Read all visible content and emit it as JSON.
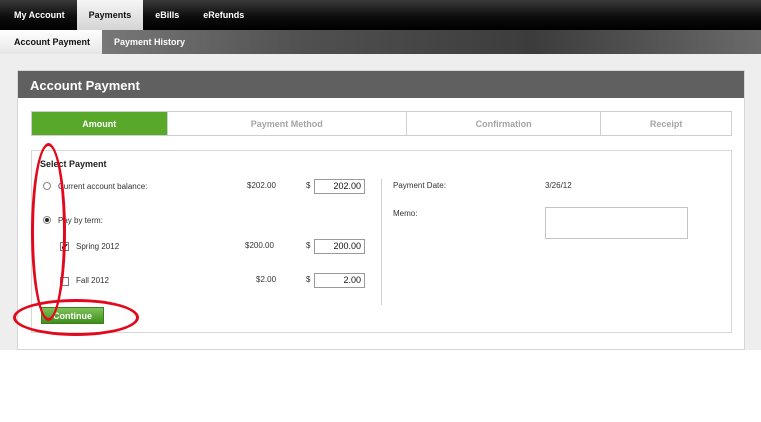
{
  "top_nav": {
    "tabs": [
      {
        "label": "My Account"
      },
      {
        "label": "Payments"
      },
      {
        "label": "eBills"
      },
      {
        "label": "eRefunds"
      }
    ]
  },
  "sub_nav": {
    "tabs": [
      {
        "label": "Account Payment"
      },
      {
        "label": "Payment History"
      }
    ]
  },
  "card": {
    "title": "Account Payment"
  },
  "steps": [
    {
      "label": "Amount"
    },
    {
      "label": "Payment Method"
    },
    {
      "label": "Confirmation"
    },
    {
      "label": "Receipt"
    }
  ],
  "select_payment": {
    "title": "Select Payment",
    "current_balance": {
      "label": "Current account balance:",
      "amount": "$202.00",
      "currency": "$",
      "value": "202.00"
    },
    "pay_by_term_label": "Pay by term:",
    "terms": [
      {
        "label": "Spring 2012",
        "amount": "$200.00",
        "currency": "$",
        "value": "200.00",
        "checked_mark": "✔"
      },
      {
        "label": "Fall 2012",
        "amount": "$2.00",
        "currency": "$",
        "value": "2.00",
        "checked_mark": ""
      }
    ]
  },
  "details": {
    "payment_date_label": "Payment Date:",
    "payment_date_value": "3/26/12",
    "memo_label": "Memo:"
  },
  "actions": {
    "continue_label": "Continue"
  },
  "colors": {
    "accent_green": "#58a82a",
    "header_gray": "#606060",
    "annotation_red": "#e3081c"
  }
}
